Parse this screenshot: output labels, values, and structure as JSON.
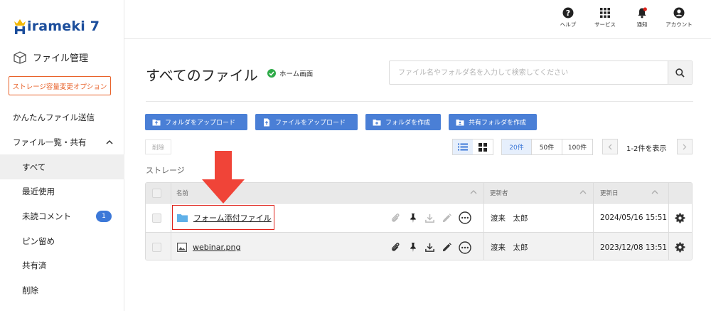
{
  "brand": {
    "logo_text": "irameki 7",
    "color": "#1c4e9c"
  },
  "sidebar": {
    "section_title": "ファイル管理",
    "storage_option_label": "ストレージ容量変更オプション",
    "items": [
      {
        "label": "かんたんファイル送信"
      },
      {
        "label": "ファイル一覧・共有"
      },
      {
        "label": "すべて"
      },
      {
        "label": "最近使用"
      },
      {
        "label": "未読コメント",
        "badge": "1"
      },
      {
        "label": "ピン留め"
      },
      {
        "label": "共有済"
      },
      {
        "label": "削除"
      }
    ]
  },
  "topbar": {
    "help": "ヘルプ",
    "services": "サービス",
    "notifications": "通知",
    "account": "アカウント"
  },
  "header": {
    "title": "すべてのファイル",
    "home_tag": "ホーム画面",
    "search_placeholder": "ファイル名やフォルダ名を入力して検索してください"
  },
  "actions": {
    "upload_folder": "フォルダをアップロード",
    "upload_file": "ファイルをアップロード",
    "create_folder": "フォルダを作成",
    "create_shared_folder": "共有フォルダを作成",
    "delete": "削除"
  },
  "pagination": {
    "per_page_options": [
      "20件",
      "50件",
      "100件"
    ],
    "selected": "20件",
    "info": "1-2件を表示"
  },
  "storage_label": "ストレージ",
  "table": {
    "columns": {
      "name": "名前",
      "updater": "更新者",
      "updated": "更新日"
    },
    "rows": [
      {
        "name": "フォーム添付ファイル",
        "type": "folder-icon",
        "updater": "渡来　太郎",
        "updated": "2024/05/16 15:51"
      },
      {
        "name": "webinar.png",
        "type": "image-icon",
        "updater": "渡来　太郎",
        "updated": "2023/12/08 13:51"
      }
    ]
  },
  "colors": {
    "accent": "#4a7fd6",
    "orange": "#e8622a",
    "red": "#e0221a"
  }
}
